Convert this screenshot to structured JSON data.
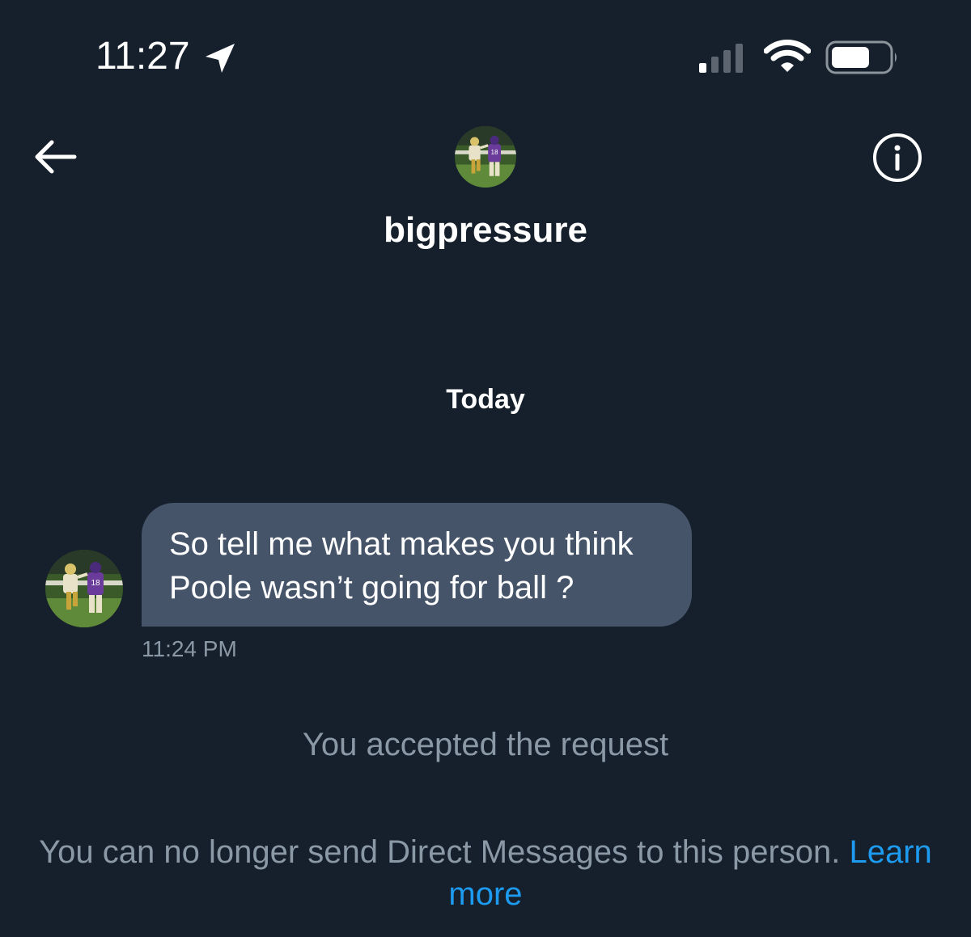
{
  "status_bar": {
    "time": "11:27",
    "location_icon": "location-arrow-icon",
    "signal_icon": "cellular-signal-icon",
    "wifi_icon": "wifi-icon",
    "battery_icon": "battery-icon"
  },
  "header": {
    "back_icon": "arrow-left-icon",
    "info_icon": "info-circle-icon",
    "username": "bigpressure"
  },
  "conversation": {
    "date_separator": "Today",
    "messages": [
      {
        "text": "So tell me what makes you think\nPoole wasn’t going for ball ?",
        "time": "11:24 PM",
        "direction": "incoming"
      }
    ],
    "accepted_notice": "You accepted the request",
    "blocked_notice": {
      "text": "You can no longer send Direct Messages to this person. ",
      "link_text": "Learn more"
    }
  },
  "colors": {
    "background": "#16202c",
    "bubble": "#46546a",
    "muted_text": "#8b98a5",
    "link": "#1d9bf0"
  }
}
